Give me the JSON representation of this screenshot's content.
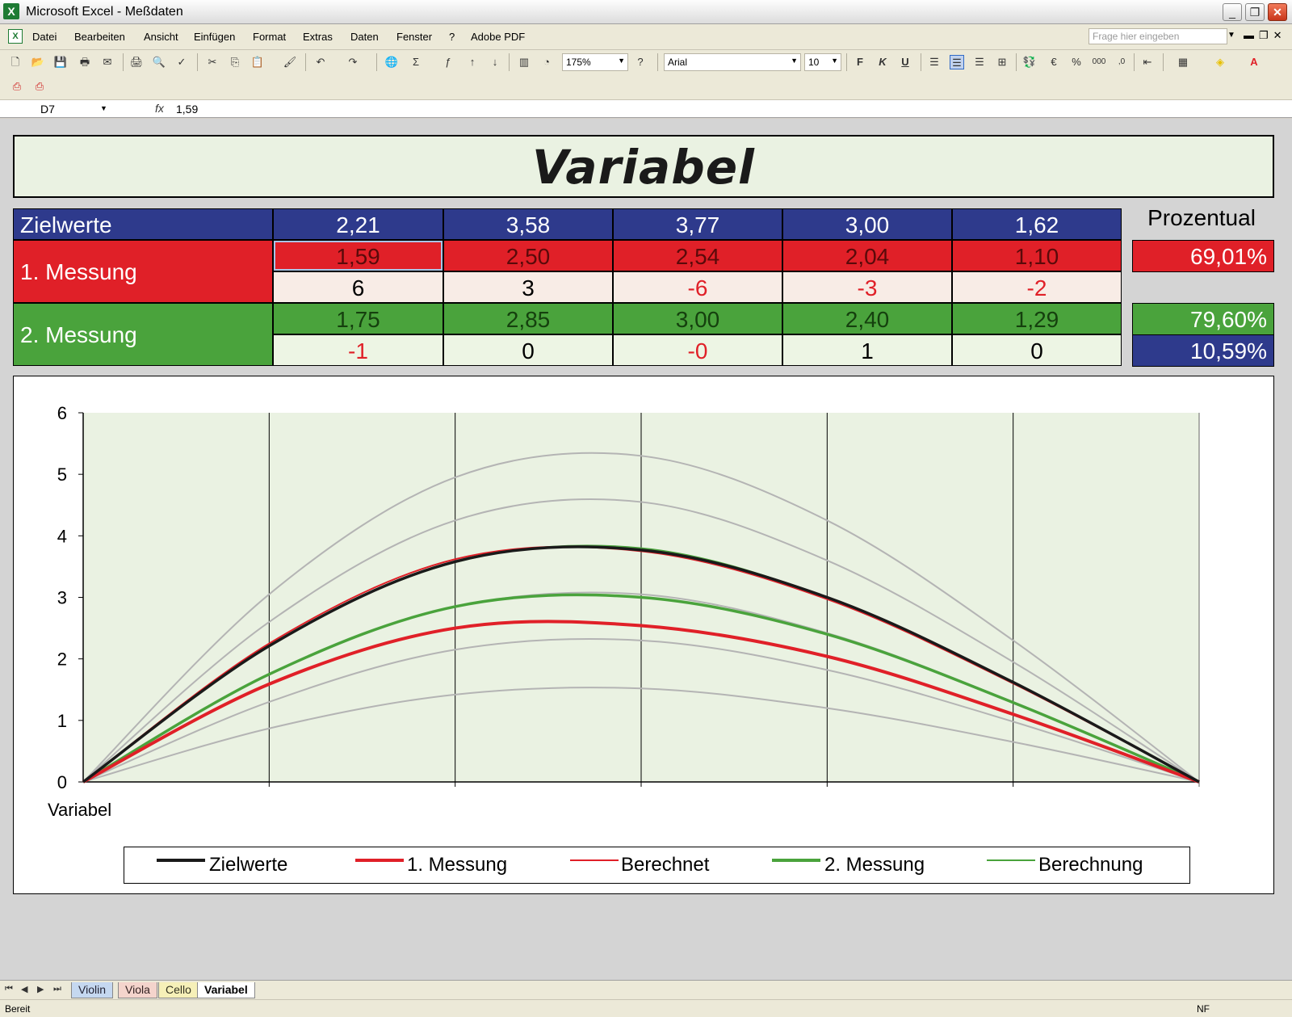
{
  "window": {
    "title": "Microsoft Excel - Meßdaten"
  },
  "menu": [
    "Datei",
    "Bearbeiten",
    "Ansicht",
    "Einfügen",
    "Format",
    "Extras",
    "Daten",
    "Fenster",
    "?",
    "Adobe PDF"
  ],
  "help_placeholder": "Frage hier eingeben",
  "toolbar": {
    "zoom": "175%",
    "font": "Arial",
    "size": "10",
    "bold_icon": "F",
    "italic_icon": "K",
    "underline_icon": "U"
  },
  "formula": {
    "cell_ref": "D7",
    "value": "1,59"
  },
  "sheet": {
    "title": "Variabel",
    "rows": {
      "zielwerte": {
        "label": "Zielwerte",
        "values": [
          "2,21",
          "3,58",
          "3,77",
          "3,00",
          "1,62"
        ]
      },
      "messung1": {
        "label": "1. Messung",
        "values": [
          "1,59",
          "2,50",
          "2,54",
          "2,04",
          "1,10"
        ],
        "diff": [
          "6",
          "3",
          "-6",
          "-3",
          "-2"
        ]
      },
      "messung2": {
        "label": "2. Messung",
        "values": [
          "1,75",
          "2,85",
          "3,00",
          "2,40",
          "1,29"
        ],
        "diff": [
          "-1",
          "0",
          "-0",
          "1",
          "0"
        ]
      }
    },
    "prozentual": {
      "label": "Prozentual",
      "messung1": "69,01%",
      "messung2": "79,60%",
      "diff": "10,59%"
    }
  },
  "chart_data": {
    "type": "line",
    "xlabel": "Variabel",
    "ylabel": "",
    "ylim": [
      0,
      6
    ],
    "yticks": [
      "0",
      "1",
      "2",
      "3",
      "4",
      "5",
      "6"
    ],
    "x": [
      0,
      1,
      2,
      3,
      4,
      5,
      6
    ],
    "grid": true,
    "legend_position": "bottom",
    "series": [
      {
        "name": "Zielwerte",
        "values": [
          0,
          2.21,
          3.58,
          3.77,
          3.0,
          1.62,
          0
        ],
        "color": "#1a1a1a"
      },
      {
        "name": "1. Messung",
        "values": [
          0,
          1.59,
          2.5,
          2.54,
          2.04,
          1.1,
          0
        ],
        "color": "#e02028"
      },
      {
        "name": "Berechnet",
        "values": [
          0,
          2.25,
          3.62,
          3.75,
          2.97,
          1.6,
          0
        ],
        "color": "#e02028"
      },
      {
        "name": "2. Messung",
        "values": [
          0,
          1.75,
          2.85,
          3.0,
          2.4,
          1.29,
          0
        ],
        "color": "#4aa33c"
      },
      {
        "name": "Berechnung",
        "values": [
          0,
          2.22,
          3.57,
          3.8,
          3.0,
          1.62,
          0
        ],
        "color": "#4aa33c"
      }
    ],
    "reference_curves": [
      {
        "values": [
          0,
          3.05,
          4.95,
          5.3,
          4.25,
          2.3,
          0
        ]
      },
      {
        "values": [
          0,
          2.6,
          4.25,
          4.55,
          3.6,
          1.95,
          0
        ]
      },
      {
        "values": [
          0,
          1.75,
          2.85,
          3.05,
          2.42,
          1.3,
          0
        ]
      },
      {
        "values": [
          0,
          1.3,
          2.15,
          2.3,
          1.82,
          0.98,
          0
        ]
      },
      {
        "values": [
          0,
          0.87,
          1.42,
          1.52,
          1.2,
          0.65,
          0
        ]
      }
    ]
  },
  "tabs": [
    "Violin",
    "Viola",
    "Cello",
    "Variabel"
  ],
  "status": {
    "left": "Bereit",
    "right": "NF"
  }
}
